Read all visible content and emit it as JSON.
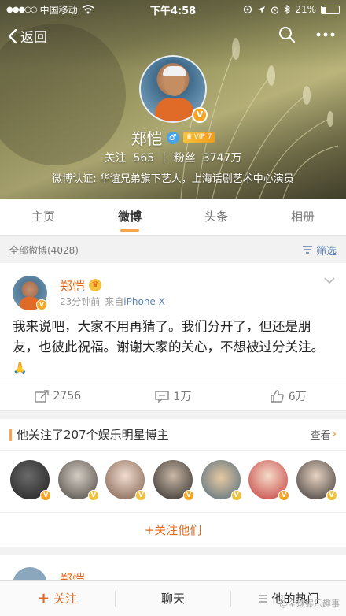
{
  "status_bar": {
    "carrier": "中国移动",
    "time": "下午4:58",
    "battery": "21%"
  },
  "nav": {
    "back_label": "返回"
  },
  "profile": {
    "name": "郑恺",
    "vip_label": "VIP 7",
    "following_label": "关注",
    "following_count": "565",
    "followers_label": "粉丝",
    "followers_count": "3747万",
    "verification": "微博认证: 华谊兄弟旗下艺人，上海话剧艺术中心演员"
  },
  "tabs": [
    {
      "label": "主页"
    },
    {
      "label": "微博"
    },
    {
      "label": "头条"
    },
    {
      "label": "相册"
    }
  ],
  "filter": {
    "all_posts": "全部微博(4028)",
    "filter_label": "筛选"
  },
  "post": {
    "author": "郑恺",
    "time": "23分钟前",
    "source_prefix": "来自",
    "device": "iPhone X",
    "text": "我来说吧，大家不用再猜了。我们分开了，但还是朋友，也彼此祝福。谢谢大家的关心，不想被过分关注。",
    "emoji": "🙏",
    "reposts": "2756",
    "comments": "1万",
    "likes": "6万"
  },
  "follow_card": {
    "title": "他关注了207个娱乐明星博主",
    "more_label": "查看",
    "cta_label": "+关注他们"
  },
  "peek": {
    "name": "郑恺"
  },
  "bottom_bar": {
    "follow": "关注",
    "chat": "聊天",
    "hot": "他的热门"
  },
  "watermark": "@全球娱乐趣事",
  "colors": {
    "accent": "#e0691a",
    "tab_underline": "#f7a64b",
    "link": "#5a7fb5",
    "vip": "#f6a623"
  }
}
